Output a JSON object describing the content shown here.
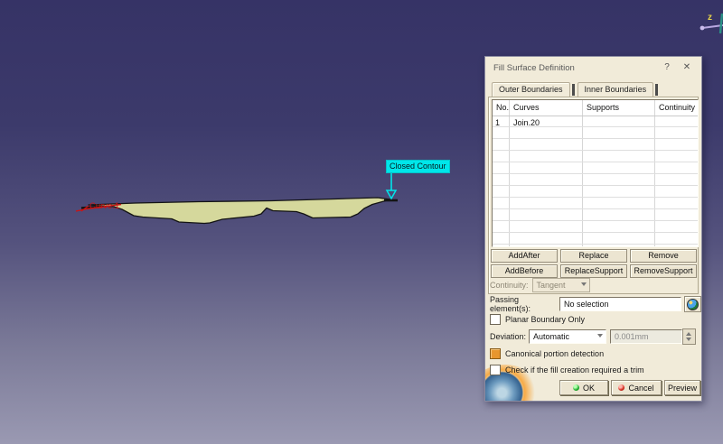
{
  "viewport": {
    "annotation_label": "Closed Contour",
    "curve_label": "Curve.1",
    "compass_z": "z",
    "colors": {
      "background_top": "#363366",
      "background_bottom": "#9a99b2",
      "surface_fill": "#d5d89c",
      "surface_outline": "#141414",
      "annotation_bg": "#00e6ea",
      "curve_highlight": "#cc1414",
      "compass_axis": "#b9a8e0",
      "compass_z_color": "#e8d44a"
    }
  },
  "dialog": {
    "title": "Fill Surface Definition",
    "help_glyph": "?",
    "close_glyph": "✕",
    "tabs": [
      {
        "label": "Outer Boundaries"
      },
      {
        "label": "Inner Boundaries"
      }
    ],
    "table": {
      "headers": [
        "No.",
        "Curves",
        "Supports",
        "Continuity"
      ],
      "rows": [
        {
          "no": "1",
          "curves": "Join.20",
          "supports": "",
          "continuity": ""
        }
      ]
    },
    "buttons": {
      "add_after": "AddAfter",
      "replace": "Replace",
      "remove": "Remove",
      "add_before": "AddBefore",
      "replace_support": "ReplaceSupport",
      "remove_support": "RemoveSupport"
    },
    "continuity_row": {
      "label": "Continuity:",
      "value": "Tangent"
    },
    "passing_row": {
      "label": "Passing element(s):",
      "value": "No selection"
    },
    "planar_checkbox_label": "Planar Boundary Only",
    "deviation_row": {
      "label": "Deviation:",
      "mode": "Automatic",
      "value": "0.001mm"
    },
    "canonical_checkbox_label": "Canonical portion detection",
    "trim_checkbox_label": "Check if the fill creation required a trim",
    "footer": {
      "ok": "OK",
      "cancel": "Cancel",
      "preview": "Preview"
    }
  }
}
